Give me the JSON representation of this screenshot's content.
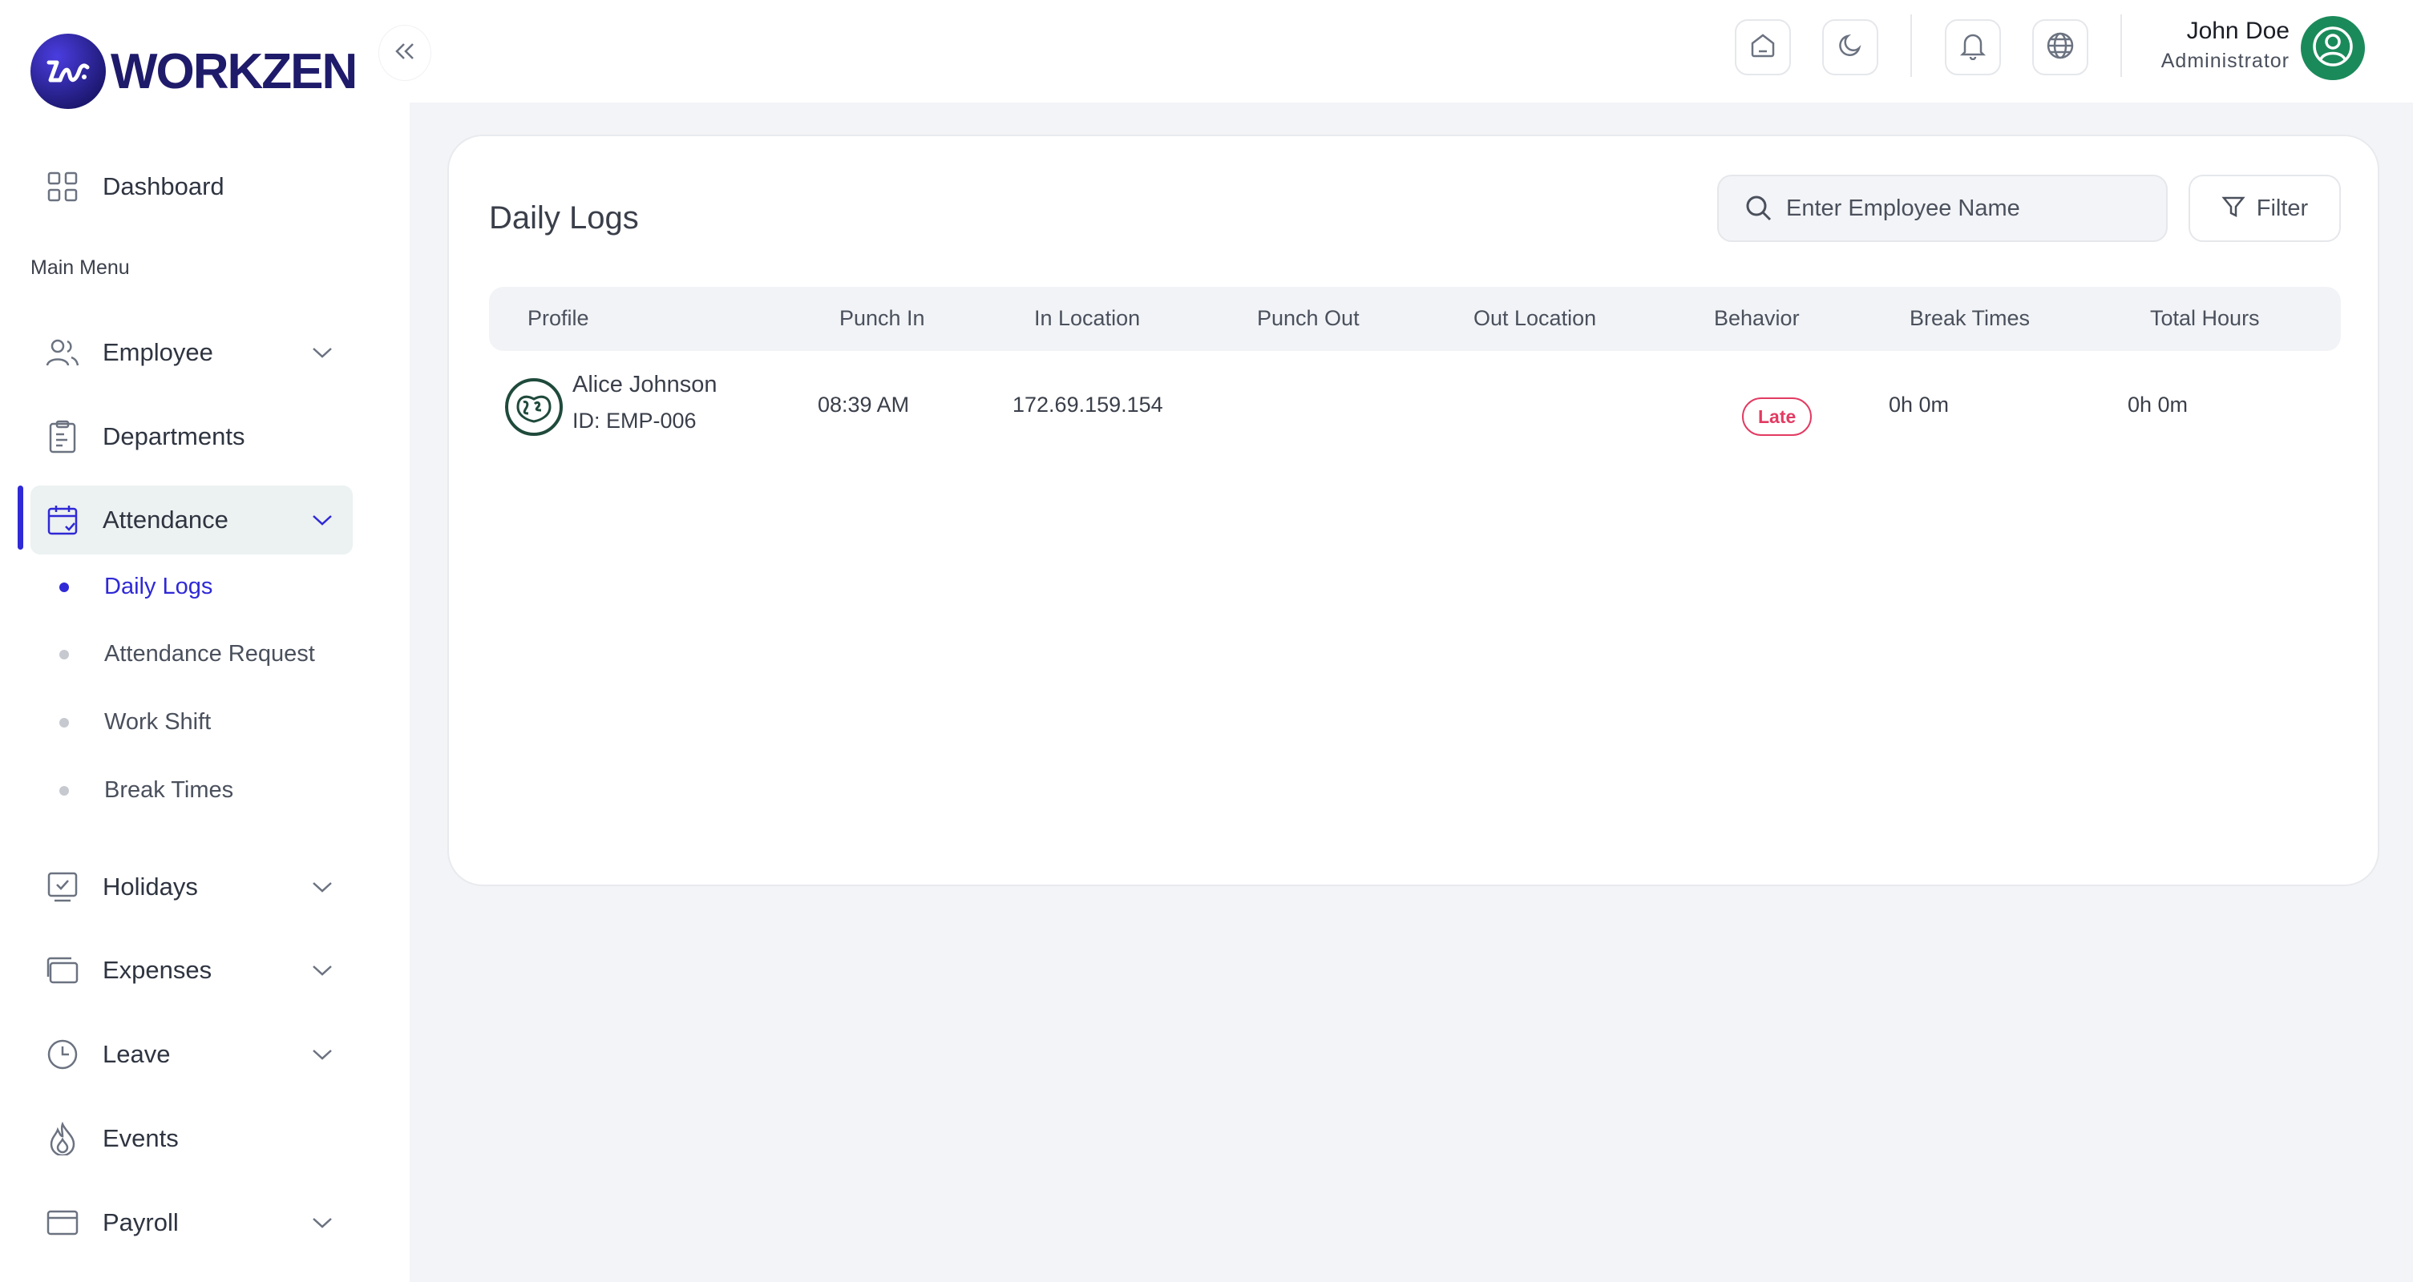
{
  "brand": {
    "name": "WORKZEN"
  },
  "sidebar": {
    "dashboard": "Dashboard",
    "section_label": "Main Menu",
    "items": [
      {
        "label": "Employee",
        "icon": "users-icon"
      },
      {
        "label": "Departments",
        "icon": "clipboard-icon"
      },
      {
        "label": "Attendance",
        "icon": "calendar-check-icon"
      },
      {
        "label": "Holidays",
        "icon": "monitor-check-icon"
      },
      {
        "label": "Expenses",
        "icon": "wallet-icon"
      },
      {
        "label": "Leave",
        "icon": "clock-icon"
      },
      {
        "label": "Events",
        "icon": "flame-icon"
      },
      {
        "label": "Payroll",
        "icon": "credit-card-icon"
      }
    ],
    "attendance_sub": [
      "Daily Logs",
      "Attendance Request",
      "Work Shift",
      "Break Times"
    ],
    "active_item": "Attendance",
    "active_sub": "Daily Logs"
  },
  "topbar": {
    "user": {
      "name": "John Doe",
      "role": "Administrator"
    },
    "icons": [
      "home-icon",
      "moon-icon",
      "bell-icon",
      "globe-icon"
    ]
  },
  "page": {
    "title": "Daily Logs",
    "search_placeholder": "Enter Employee Name",
    "filter_label": "Filter",
    "columns": [
      "Profile",
      "Punch In",
      "In Location",
      "Punch Out",
      "Out Location",
      "Behavior",
      "Break Times",
      "Total Hours"
    ],
    "rows": [
      {
        "name": "Alice Johnson",
        "id": "ID: EMP-006",
        "punch_in": "08:39 AM",
        "in_location": "172.69.159.154",
        "punch_out": "",
        "out_location": "",
        "behavior": "Late",
        "break_times": "0h 0m",
        "total_hours": "0h 0m"
      }
    ]
  },
  "colors": {
    "accent": "#2f29d6",
    "late": "#e23b62",
    "avatar": "#1b8a5a"
  }
}
